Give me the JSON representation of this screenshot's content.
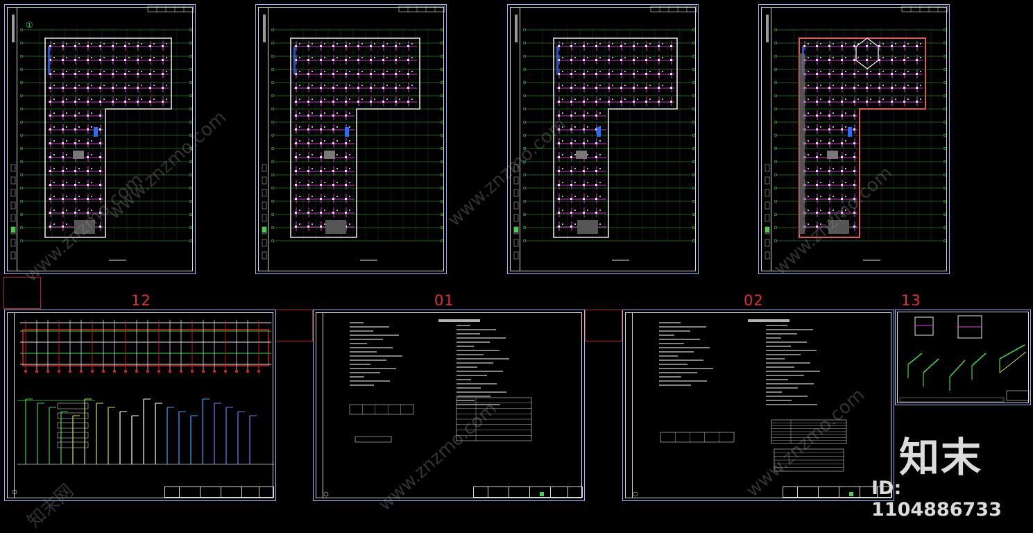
{
  "sheets": {
    "schematic_label": "12",
    "notes_a_label": "01",
    "notes_b_label": "02",
    "details_label": "13"
  },
  "floor_plan_marker": "①",
  "brand": {
    "logo_text": "知末",
    "id_text": "ID: 1104886733",
    "watermark": "www.znzmo.com",
    "watermark_cn": "知末网"
  },
  "colors": {
    "background": "#000000",
    "sheet_frame": "#8fb7ff",
    "grid_green": "#44d14a",
    "pipe_magenta": "#e23be0",
    "wall_white": "#e6e6e6",
    "pipe_red": "#e02424",
    "sheet_number": "#e03030",
    "accent_blue": "#2a6cff"
  }
}
